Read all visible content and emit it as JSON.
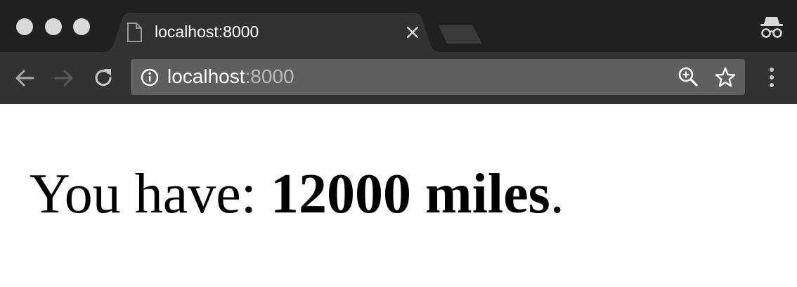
{
  "browser": {
    "tab": {
      "title": "localhost:8000",
      "icon": "page-icon"
    },
    "address": {
      "host": "localhost",
      "port": ":8000"
    },
    "colors": {
      "titlebar": "#202020",
      "tab": "#323232",
      "omnibox": "#5f5f5f"
    }
  },
  "page": {
    "prefix": "You have: ",
    "amount": "12000 miles",
    "suffix": "."
  }
}
